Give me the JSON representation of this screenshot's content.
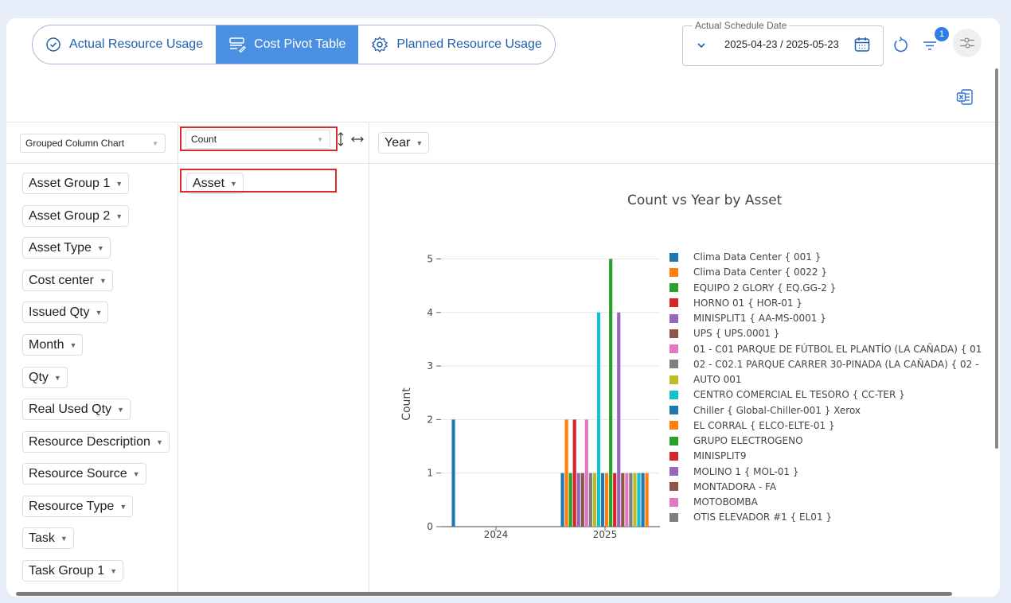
{
  "tabs": [
    {
      "label": "Actual Resource Usage",
      "icon": "check-circle-icon",
      "active": false
    },
    {
      "label": "Cost Pivot Table",
      "icon": "table-edit-icon",
      "active": true
    },
    {
      "label": "Planned Resource Usage",
      "icon": "gear-icon",
      "active": false
    }
  ],
  "date_filter": {
    "label": "Actual Schedule Date",
    "value": "2025-04-23 / 2025-05-23"
  },
  "filter_badge": "1",
  "chart_type_select": "Grouped Column Chart",
  "aggregator_select": "Count",
  "column_field": "Year",
  "row_field": "Asset",
  "fields": [
    "Asset Group 1",
    "Asset Group 2",
    "Asset Type",
    "Cost center",
    "Issued Qty",
    "Month",
    "Qty",
    "Real Used Qty",
    "Resource Description",
    "Resource Source",
    "Resource Type",
    "Task",
    "Task Group 1"
  ],
  "colors": [
    "#1f77b4",
    "#ff7f0e",
    "#2ca02c",
    "#d62728",
    "#9467bd",
    "#8c564b",
    "#e377c2",
    "#7f7f7f",
    "#bcbd22",
    "#17becf"
  ],
  "chart_data": {
    "type": "bar",
    "title": "Count vs Year by Asset",
    "xlabel": "",
    "ylabel": "Count",
    "categories": [
      "2024",
      "2025"
    ],
    "ylim": [
      0,
      5.5
    ],
    "yticks": [
      0,
      1,
      2,
      3,
      4,
      5
    ],
    "series": [
      {
        "name": "Clima Data Center { 001 }",
        "values": [
          2,
          1
        ]
      },
      {
        "name": "Clima Data Center { 0022 }",
        "values": [
          0,
          2
        ]
      },
      {
        "name": "EQUIPO 2 GLORY { EQ.GG-2 }",
        "values": [
          0,
          1
        ]
      },
      {
        "name": "HORNO 01 { HOR-01 }",
        "values": [
          0,
          2
        ]
      },
      {
        "name": "MINISPLIT1 { AA-MS-0001 }",
        "values": [
          0,
          1
        ]
      },
      {
        "name": "UPS { UPS.0001 }",
        "values": [
          0,
          1
        ]
      },
      {
        "name": "01 - C01 PARQUE DE FÚTBOL EL PLANTÍO (LA CAÑADA) { 01",
        "values": [
          0,
          2
        ]
      },
      {
        "name": "02 - C02.1 PARQUE CARRER 30-PINADA (LA CAÑADA) { 02 -",
        "values": [
          0,
          1
        ]
      },
      {
        "name": "AUTO 001",
        "values": [
          0,
          1
        ]
      },
      {
        "name": "CENTRO COMERCIAL EL TESORO { CC-TER }",
        "values": [
          0,
          4
        ]
      },
      {
        "name": "Chiller { Global-Chiller-001 } Xerox",
        "values": [
          0,
          1
        ]
      },
      {
        "name": "EL CORRAL { ELCO-ELTE-01 }",
        "values": [
          0,
          1
        ]
      },
      {
        "name": "GRUPO ELECTROGENO",
        "values": [
          0,
          5
        ]
      },
      {
        "name": "MINISPLIT9",
        "values": [
          0,
          1
        ]
      },
      {
        "name": "MOLINO 1 { MOL-01 }",
        "values": [
          0,
          4
        ]
      },
      {
        "name": "MONTADORA - FA",
        "values": [
          0,
          1
        ]
      },
      {
        "name": "MOTOBOMBA",
        "values": [
          0,
          1
        ]
      },
      {
        "name": "OTIS ELEVADOR #1 { EL01 }",
        "values": [
          0,
          1
        ]
      },
      {
        "name": "",
        "values": [
          0,
          1
        ]
      },
      {
        "name": "",
        "values": [
          0,
          1
        ]
      },
      {
        "name": "",
        "values": [
          0,
          1
        ]
      },
      {
        "name": "",
        "values": [
          0,
          1
        ]
      }
    ]
  }
}
